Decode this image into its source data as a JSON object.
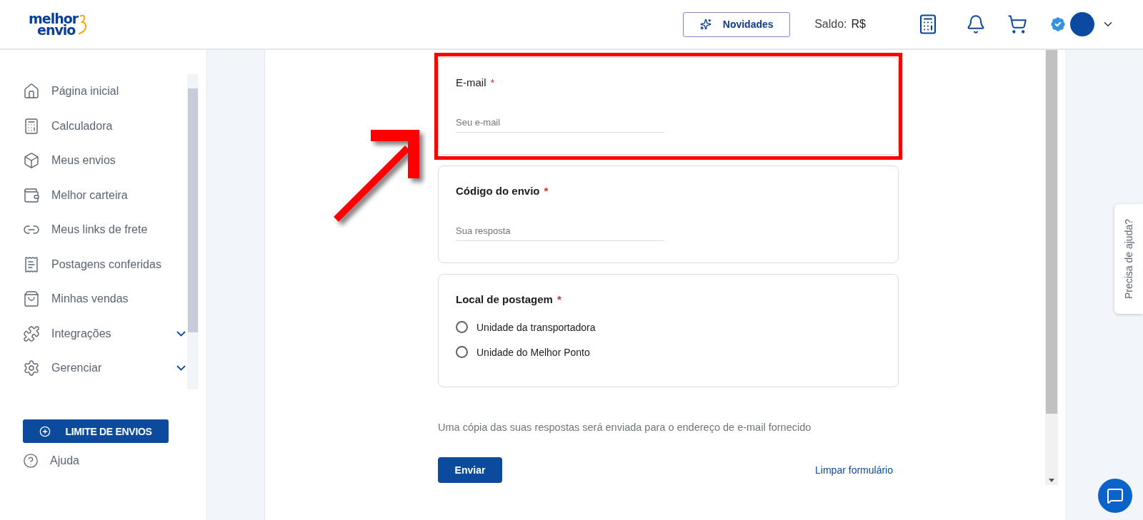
{
  "header": {
    "logo": [
      "melhor",
      "envio"
    ],
    "news_button": "Novidades",
    "balance_label": "Saldo:",
    "balance_value": "R$"
  },
  "sidebar": {
    "items": [
      {
        "label": "Página inicial"
      },
      {
        "label": "Calculadora"
      },
      {
        "label": "Meus envios"
      },
      {
        "label": "Melhor carteira"
      },
      {
        "label": "Meus links de frete"
      },
      {
        "label": "Postagens conferidas"
      },
      {
        "label": "Minhas vendas"
      },
      {
        "label": "Integrações",
        "expanded": false
      },
      {
        "label": "Gerenciar",
        "expanded": false
      }
    ],
    "limit_button": "LIMITE DE ENVIOS",
    "help": "Ajuda"
  },
  "form": {
    "questions": [
      {
        "kind": "text",
        "label": "E-mail",
        "required": "*",
        "placeholder": "Seu e-mail",
        "highlighted": true
      },
      {
        "kind": "text",
        "label": "Código do envio",
        "required": "*",
        "placeholder": "Sua resposta",
        "highlighted": false
      },
      {
        "kind": "radio",
        "label": "Local de postagem",
        "required": "*",
        "options": [
          {
            "label": "Unidade da transportadora",
            "selected": false
          },
          {
            "label": "Unidade do Melhor Ponto",
            "selected": false
          }
        ]
      }
    ],
    "note": "Uma cópia das suas respostas será enviada para o endereço de e-mail fornecido",
    "submit": "Enviar",
    "clear": "Limpar formulário"
  },
  "help_tab": "Precisa de ajuda?"
}
